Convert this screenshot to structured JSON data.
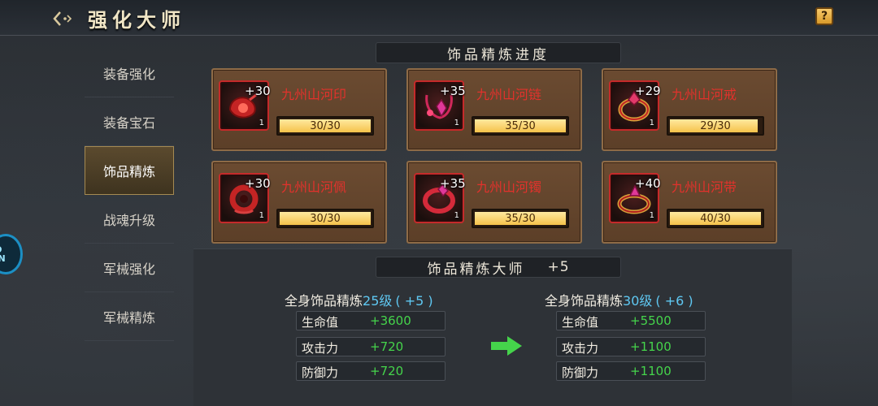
{
  "header": {
    "title": "强化大师",
    "back_icon": "back-arrow-icon",
    "help_label": "?"
  },
  "side_badge": {
    "text": "JO AN"
  },
  "sidebar": {
    "items": [
      {
        "label": "装备强化",
        "active": false
      },
      {
        "label": "装备宝石",
        "active": false
      },
      {
        "label": "饰品精炼",
        "active": true
      },
      {
        "label": "战魂升级",
        "active": false
      },
      {
        "label": "军械强化",
        "active": false
      },
      {
        "label": "军械精炼",
        "active": false
      }
    ]
  },
  "progress_section": {
    "title": "饰品精炼进度",
    "items": [
      {
        "name": "九州山河印",
        "level": "+30",
        "count": "1",
        "progress": "30/30",
        "fraction": 1.0,
        "icon": "jade-seal-icon"
      },
      {
        "name": "九州山河链",
        "level": "+35",
        "count": "1",
        "progress": "35/30",
        "fraction": 1.0,
        "icon": "necklace-icon"
      },
      {
        "name": "九州山河戒",
        "level": "+29",
        "count": "1",
        "progress": "29/30",
        "fraction": 0.967,
        "icon": "ring-icon"
      },
      {
        "name": "九州山河佩",
        "level": "+30",
        "count": "1",
        "progress": "30/30",
        "fraction": 1.0,
        "icon": "pendant-icon"
      },
      {
        "name": "九州山河镯",
        "level": "+35",
        "count": "1",
        "progress": "35/30",
        "fraction": 1.0,
        "icon": "bracelet-icon"
      },
      {
        "name": "九州山河带",
        "level": "+40",
        "count": "1",
        "progress": "40/30",
        "fraction": 1.0,
        "icon": "belt-icon"
      }
    ]
  },
  "master_section": {
    "title": "饰品精炼大师",
    "level": "+5",
    "current": {
      "prefix": "全身饰品精炼",
      "tier": "25级",
      "bonus": "( +5 )",
      "stats": [
        {
          "label": "生命值",
          "value": "+3600"
        },
        {
          "label": "攻击力",
          "value": "+720"
        },
        {
          "label": "防御力",
          "value": "+720"
        }
      ]
    },
    "next": {
      "prefix": "全身饰品精炼",
      "tier": "30级",
      "bonus": "( +6 )",
      "stats": [
        {
          "label": "生命值",
          "value": "+5500"
        },
        {
          "label": "攻击力",
          "value": "+1100"
        },
        {
          "label": "防御力",
          "value": "+1100"
        }
      ]
    },
    "arrow_icon": "right-arrow-icon",
    "arrow_color": "#45d44b"
  }
}
